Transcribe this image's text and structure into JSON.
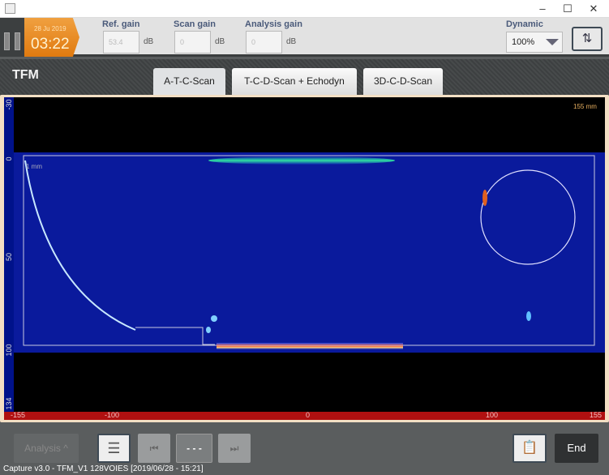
{
  "window": {
    "minimize": "–",
    "maximize": "☐",
    "close": "✕"
  },
  "clock": {
    "date": "28 Ju 2019",
    "time": "03:22"
  },
  "gains": {
    "ref": {
      "label": "Ref. gain",
      "value": "53.4",
      "unit": "dB"
    },
    "scan": {
      "label": "Scan gain",
      "value": "0",
      "unit": "dB"
    },
    "analysis": {
      "label": "Analysis gain",
      "value": "0",
      "unit": "dB"
    }
  },
  "dynamic": {
    "label": "Dynamic",
    "value": "100%"
  },
  "swap_icon": "⇅",
  "mode": "TFM",
  "tabs": [
    {
      "label": "A-T-C-Scan",
      "active": true
    },
    {
      "label": "T-C-D-Scan + Echodyn"
    },
    {
      "label": "3D-C-D-Scan"
    }
  ],
  "scan": {
    "left_axis": [
      "-30",
      "0",
      "50",
      "100",
      "134"
    ],
    "bottom_axis": [
      "-155",
      "-100",
      "0",
      "100",
      "155"
    ],
    "top_right_label": "155 mm",
    "roi_label": "1 mm",
    "colormap": {
      "background": "#000000",
      "low": "#0a1fb0",
      "mid": "#20c0ff",
      "high": "#ffe020",
      "max": "#d01010"
    }
  },
  "bottom": {
    "analysis": "Analysis ^",
    "list_icon": "☰",
    "prev_icon": "⏮",
    "middle": "- - -",
    "next_icon": "⏭",
    "clipboard_icon": "📋",
    "end": "End"
  },
  "status": "Capture v3.0 - TFM_V1 128VOIES [2019/06/28 - 15:21]"
}
